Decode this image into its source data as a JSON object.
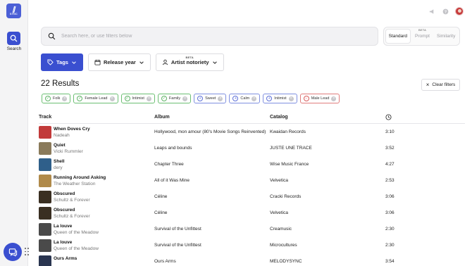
{
  "app": {
    "logo_text": "SYNC",
    "nav_search_label": "Search"
  },
  "search": {
    "placeholder": "Search here, or use filters below",
    "value": ""
  },
  "mode_toggle": {
    "options": [
      "Standard",
      "Prompt",
      "Similarity"
    ],
    "active": "Standard",
    "beta_label": "BETA"
  },
  "filters": {
    "tags_label": "Tags",
    "release_year_label": "Release year",
    "artist_notoriety_label": "Artist notoriety",
    "beta_label": "BETA"
  },
  "results": {
    "count_label": "22 Results",
    "clear_filters_label": "Clear filters"
  },
  "tag_chips": [
    {
      "label": "Folk",
      "mode": "include",
      "symbol": "✓"
    },
    {
      "label": "Female Lead",
      "mode": "include",
      "symbol": "✓"
    },
    {
      "label": "Intimist",
      "mode": "include",
      "symbol": "✓"
    },
    {
      "label": "Family",
      "mode": "include",
      "symbol": "✓"
    },
    {
      "label": "Sweet",
      "mode": "optional",
      "symbol": "+"
    },
    {
      "label": "Calm",
      "mode": "optional",
      "symbol": "+"
    },
    {
      "label": "Intimist",
      "mode": "optional",
      "symbol": "+"
    },
    {
      "label": "Male Lead",
      "mode": "exclude",
      "symbol": "−"
    }
  ],
  "table": {
    "headers": {
      "track": "Track",
      "album": "Album",
      "catalog": "Catalog"
    },
    "rows": [
      {
        "title": "When Doves Cry",
        "artist": "Nadeah",
        "album": "Hollywood, mon amour (80's Movie Songs Reinvented)",
        "catalog": "Kwaidan Records",
        "duration": "3:10",
        "cover": "#c23a3a"
      },
      {
        "title": "Quiet",
        "artist": "Vicki Rummler",
        "album": "Leaps and bounds",
        "catalog": "JUSTE UNE TRACE",
        "duration": "3:52",
        "cover": "#8a7a5a"
      },
      {
        "title": "Shell",
        "artist": "dery",
        "album": "Chapter Three",
        "catalog": "Wise Music France",
        "duration": "4:27",
        "cover": "#2f5f8a"
      },
      {
        "title": "Running Around Asking",
        "artist": "The Weather Station",
        "album": "All of it Was Mine",
        "catalog": "Velvetica",
        "duration": "2:53",
        "cover": "#b08a4a"
      },
      {
        "title": "Obscured",
        "artist": "Schultz & Forever",
        "album": "Céline",
        "catalog": "Cracki Records",
        "duration": "3:06",
        "cover": "#3a2f22"
      },
      {
        "title": "Obscured",
        "artist": "Schultz & Forever",
        "album": "Céline",
        "catalog": "Velvetica",
        "duration": "3:06",
        "cover": "#3a2f22"
      },
      {
        "title": "La louve",
        "artist": "Queen of the Meadow",
        "album": "Survival of the Unfittest",
        "catalog": "Creamusic",
        "duration": "2:30",
        "cover": "#4a4a4a"
      },
      {
        "title": "La louve",
        "artist": "Queen of the Meadow",
        "album": "Survival of the Unfittest",
        "catalog": "Microcultures",
        "duration": "2:30",
        "cover": "#4a4a4a"
      },
      {
        "title": "Ours Arms",
        "artist": "",
        "album": "Ours Arms",
        "catalog": "MELODYSYNC",
        "duration": "3:54",
        "cover": "#2a3550"
      }
    ]
  },
  "colors": {
    "accent": "#3a4fd0",
    "include": "#5fb366",
    "optional": "#5d70d8",
    "exclude": "#d95b5b"
  }
}
